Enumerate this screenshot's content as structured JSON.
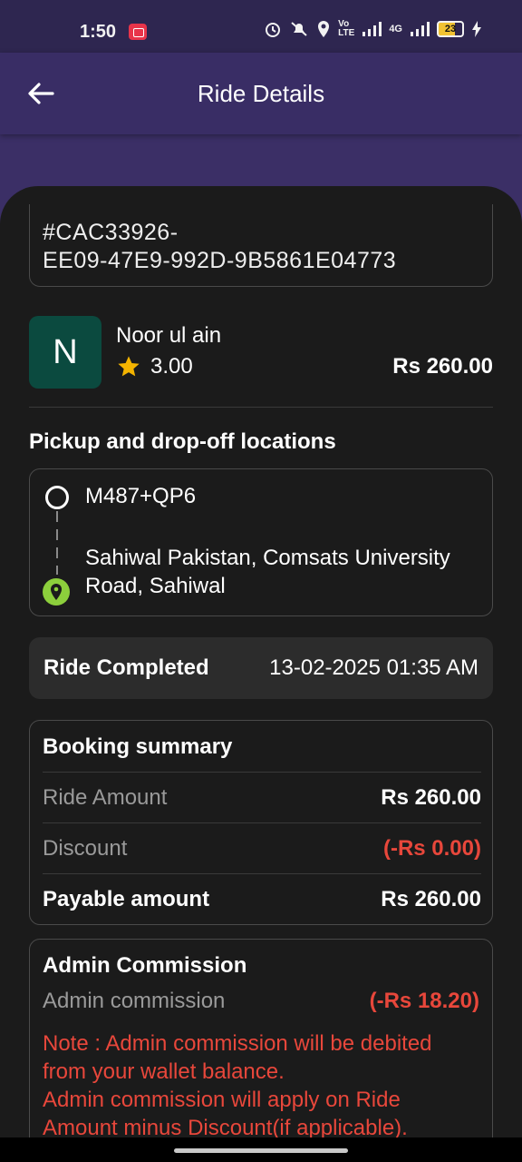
{
  "status_bar": {
    "time": "1:50",
    "battery": "23",
    "network": "4G",
    "icons": [
      "screen-record-icon",
      "alarm-icon",
      "mute-icon",
      "location-icon",
      "volte-icon",
      "signal-icon",
      "battery-icon",
      "charging-icon"
    ]
  },
  "app_bar": {
    "title": "Ride Details",
    "back_icon": "arrow-left-icon"
  },
  "ride": {
    "id": "#CAC33926-\nEE09-47E9-992D-9B5861E04773"
  },
  "driver": {
    "initial": "N",
    "name": "Noor ul ain",
    "rating": "3.00",
    "price": "Rs 260.00",
    "avatar_color": "#0b4a3f"
  },
  "locations": {
    "title": "Pickup and drop-off locations",
    "pickup": "M487+QP6",
    "dropoff": "Sahiwal Pakistan, Comsats University Road, Sahiwal"
  },
  "status": {
    "label": "Ride Completed",
    "datetime": "13-02-2025 01:35 AM"
  },
  "booking_summary": {
    "title": "Booking summary",
    "rows": [
      {
        "label": "Ride Amount",
        "value": "Rs 260.00"
      },
      {
        "label": "Discount",
        "value": "(-Rs 0.00)"
      },
      {
        "label": "Payable amount",
        "value": "Rs 260.00"
      }
    ]
  },
  "admin": {
    "title": "Admin Commission",
    "label": "Admin commission",
    "value": "(-Rs 18.20)",
    "note": "Note : Admin commission will be debited from your wallet balance.\n Admin commission will apply on Ride Amount minus Discount(if applicable)."
  },
  "colors": {
    "app_bar": "#392d65",
    "sheet": "#1b1b1b",
    "accent_red": "#e8473b",
    "star": "#f4b400",
    "drop_pin": "#8ccf3c"
  }
}
